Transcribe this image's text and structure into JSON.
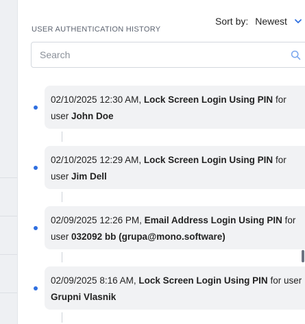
{
  "history": {
    "title": "USER AUTHENTICATION HISTORY",
    "sort_label": "Sort by:",
    "sort_value": "Newest",
    "search_placeholder": "Search",
    "search_value": "",
    "events": [
      {
        "timestamp": "02/10/2025 12:30 AM,",
        "action": "Lock Screen Login Using PIN",
        "connector": "for user",
        "user": "John Doe"
      },
      {
        "timestamp": "02/10/2025 12:29 AM,",
        "action": "Lock Screen Login Using PIN",
        "connector": "for user",
        "user": "Jim Dell"
      },
      {
        "timestamp": "02/09/2025 12:26 PM,",
        "action": "Email Address Login Using PIN",
        "connector": "for user",
        "user": "032092 bb (grupa@mono.software)"
      },
      {
        "timestamp": "02/09/2025 8:16 AM,",
        "action": "Lock Screen Login Using PIN",
        "connector": "for user",
        "user": "Grupni Vlasnik"
      }
    ]
  },
  "colors": {
    "accent": "#2f6fe0",
    "card_bg": "#f1f2f4",
    "backdrop": "#eef0f3"
  },
  "icons": {
    "search": "search-icon",
    "sort": "chevron-down-icon"
  }
}
